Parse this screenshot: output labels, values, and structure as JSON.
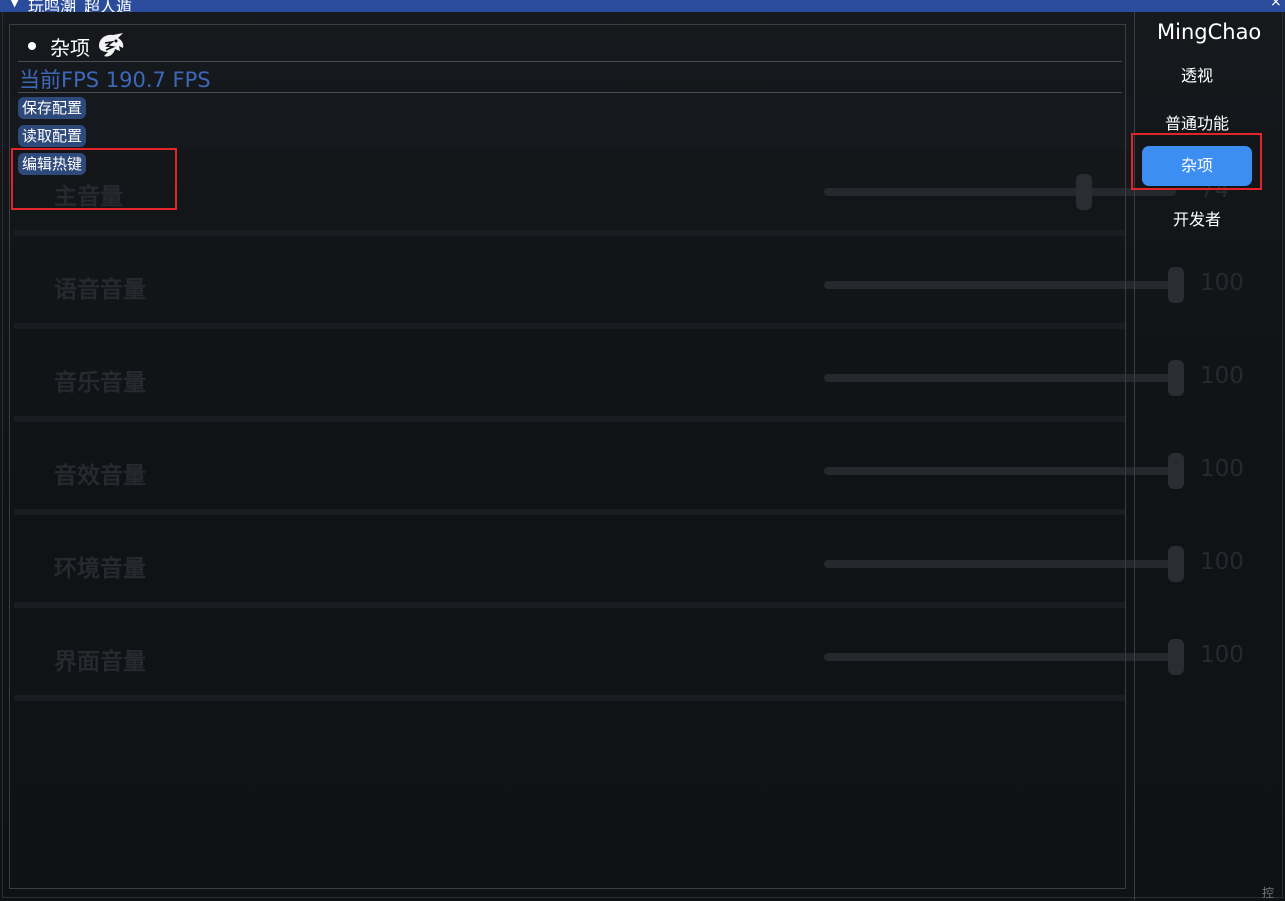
{
  "window": {
    "title": "玩鸣潮_超人遁",
    "collapse_icon": "triangle-down-icon",
    "close_label": "×"
  },
  "section": {
    "title": "杂项",
    "icon": "dragon-logo-icon"
  },
  "fps_text": "当前FPS 190.7 FPS",
  "buttons": {
    "save": "保存配置",
    "load": "读取配置",
    "hotkey": "编辑热键"
  },
  "sidebar": {
    "brand": "MingChao",
    "items": [
      {
        "label": "透视",
        "active": false
      },
      {
        "label": "普通功能",
        "active": false
      },
      {
        "label": "杂项",
        "active": true
      },
      {
        "label": "开发者",
        "active": false
      }
    ]
  },
  "background_settings": [
    {
      "label": "主音量",
      "value": "74",
      "level": 0.74
    },
    {
      "label": "语音音量",
      "value": "100",
      "level": 1.0
    },
    {
      "label": "音乐音量",
      "value": "100",
      "level": 1.0
    },
    {
      "label": "音效音量",
      "value": "100",
      "level": 1.0
    },
    {
      "label": "环境音量",
      "value": "100",
      "level": 1.0
    },
    {
      "label": "界面音量",
      "value": "100",
      "level": 1.0
    }
  ],
  "corner_text": "控",
  "colors": {
    "titlebar": "#2a4c9a",
    "accent": "#3d8ef2",
    "fps_text": "#3d68b8",
    "pill_button": "#2e4a7a",
    "highlight": "#e0262b"
  }
}
